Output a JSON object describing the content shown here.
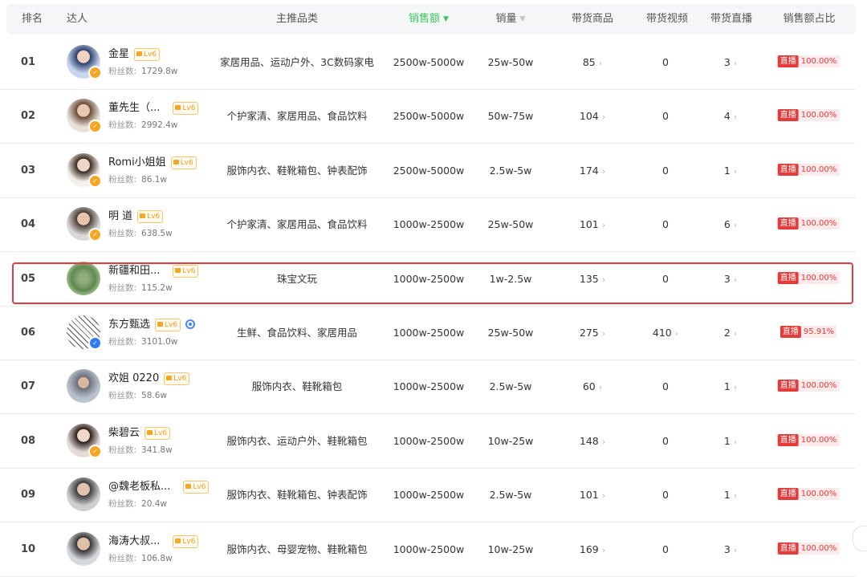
{
  "header": {
    "rank": "排名",
    "influencer": "达人",
    "category": "主推品类",
    "sales_amount": "销售额",
    "sales_volume": "销量",
    "products": "带货商品",
    "videos": "带货视频",
    "lives": "带货直播",
    "share": "销售额占比"
  },
  "colors": {
    "accent": "#3cc75b",
    "live_tag": "#e63b3b",
    "highlight": "#e43c3c"
  },
  "fans_label": "粉丝数:",
  "level_label": "Lv6",
  "live_label": "直播",
  "rows": [
    {
      "rank": "01",
      "name": "金星",
      "fans": "1729.8w",
      "category": "家居用品、运动户外、3C数码家电",
      "amount": "2500w-5000w",
      "volume": "25w-50w",
      "products": "85",
      "videos": "0",
      "lives": "3",
      "share": "100.00%"
    },
    {
      "rank": "02",
      "name": "董先生（...",
      "fans": "2992.4w",
      "category": "个护家清、家居用品、食品饮料",
      "amount": "2500w-5000w",
      "volume": "50w-75w",
      "products": "104",
      "videos": "0",
      "lives": "4",
      "share": "100.00%"
    },
    {
      "rank": "03",
      "name": "Romi小姐姐",
      "fans": "86.1w",
      "category": "服饰内衣、鞋靴箱包、钟表配饰",
      "amount": "2500w-5000w",
      "volume": "2.5w-5w",
      "products": "174",
      "videos": "0",
      "lives": "1",
      "share": "100.00%"
    },
    {
      "rank": "04",
      "name": "明 道",
      "fans": "638.5w",
      "category": "个护家清、家居用品、食品饮料",
      "amount": "1000w-2500w",
      "volume": "25w-50w",
      "products": "101",
      "videos": "0",
      "lives": "6",
      "share": "100.00%"
    },
    {
      "rank": "05",
      "name": "新疆和田...",
      "fans": "115.2w",
      "category": "珠宝文玩",
      "amount": "1000w-2500w",
      "volume": "1w-2.5w",
      "products": "135",
      "videos": "0",
      "lives": "3",
      "share": "100.00%"
    },
    {
      "rank": "06",
      "name": "东方甄选",
      "fans": "3101.0w",
      "category": "生鲜、食品饮料、家居用品",
      "amount": "1000w-2500w",
      "volume": "25w-50w",
      "products": "275",
      "videos": "410",
      "lives": "2",
      "share": "95.91%"
    },
    {
      "rank": "07",
      "name": "欢姐 0220",
      "fans": "58.6w",
      "category": "服饰内衣、鞋靴箱包",
      "amount": "1000w-2500w",
      "volume": "2.5w-5w",
      "products": "60",
      "videos": "0",
      "lives": "1",
      "share": "100.00%"
    },
    {
      "rank": "08",
      "name": "柴碧云",
      "fans": "341.8w",
      "category": "服饰内衣、运动户外、鞋靴箱包",
      "amount": "1000w-2500w",
      "volume": "10w-25w",
      "products": "148",
      "videos": "0",
      "lives": "1",
      "share": "100.00%"
    },
    {
      "rank": "09",
      "name": "@魏老板私...",
      "fans": "20.4w",
      "category": "服饰内衣、鞋靴箱包、钟表配饰",
      "amount": "1000w-2500w",
      "volume": "2.5w-5w",
      "products": "101",
      "videos": "0",
      "lives": "1",
      "share": "100.00%"
    },
    {
      "rank": "10",
      "name": "海涛大叔...",
      "fans": "106.8w",
      "category": "服饰内衣、母婴宠物、鞋靴箱包",
      "amount": "1000w-2500w",
      "volume": "10w-25w",
      "products": "169",
      "videos": "0",
      "lives": "3",
      "share": "100.00%"
    }
  ]
}
